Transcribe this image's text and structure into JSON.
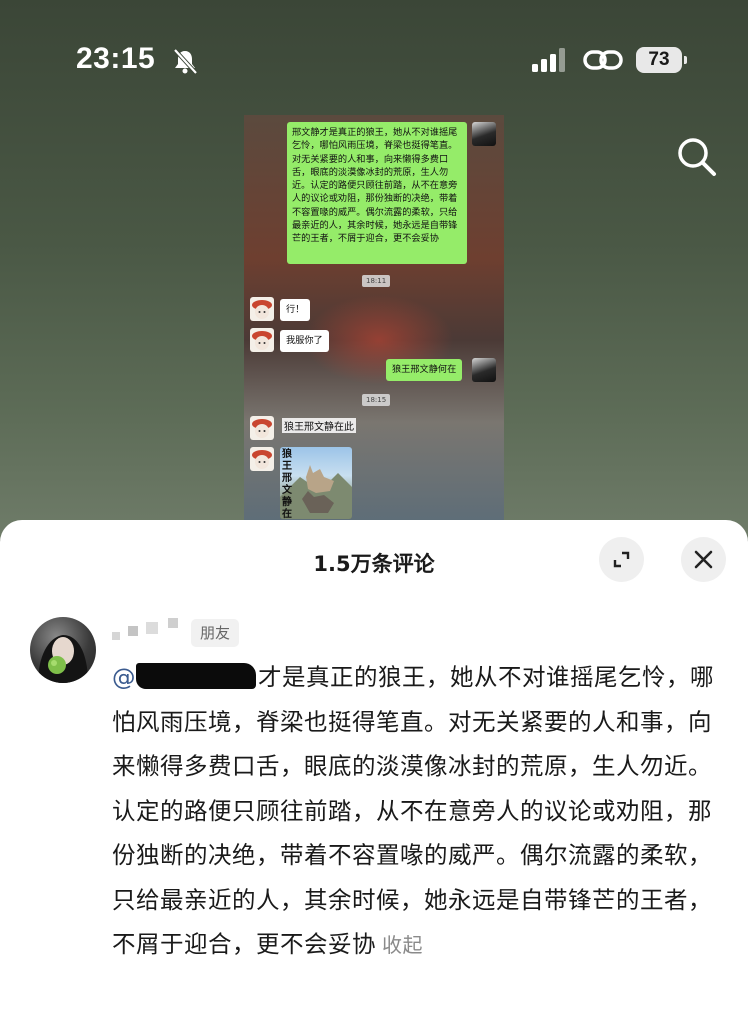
{
  "status_bar": {
    "time": "23:15",
    "battery": "73",
    "icons": [
      "mute-icon",
      "signal-icon",
      "link-icon",
      "battery-icon"
    ]
  },
  "top": {
    "icons": [
      "search-icon"
    ]
  },
  "chat_screenshot": {
    "long_message": "邢文静才是真正的狼王，她从不对谁摇尾乞怜，哪怕风雨压境，脊梁也挺得笔直。对无关紧要的人和事，向来懒得多费口舌，眼底的淡漠像冰封的荒原，生人勿近。认定的路便只顾往前踏，从不在意旁人的议论或劝阻，那份独断的决绝，带着不容置喙的威严。偶尔流露的柔软，只给最亲近的人，其余时候，她永远是自带锋芒的王者，不屑于迎合，更不会妥协",
    "timestamp_1": "18:11",
    "reply_1": "行！",
    "reply_2": "我服你了",
    "question": "狼王邢文静何在",
    "timestamp_2": "18:15",
    "answer_text": "狼王邢文静在此",
    "image_caption": "狼王邢文静在此"
  },
  "comments": {
    "title": "1.5万条评论",
    "icons": [
      "expand-icon",
      "close-icon"
    ],
    "first": {
      "tag": "朋友",
      "mention": "@",
      "text": "才是真正的狼王，她从不对谁摇尾乞怜，哪怕风雨压境，脊梁也挺得笔直。对无关紧要的人和事，向来懒得多费口舌，眼底的淡漠像冰封的荒原，生人勿近。认定的路便只顾往前踏，从不在意旁人的议论或劝阻，那份独断的决绝，带着不容置喙的威严。偶尔流露的柔软，只给最亲近的人，其余时候，她永远是自带锋芒的王者，不屑于迎合，更不会妥协",
      "collapse_label": "收起"
    }
  }
}
